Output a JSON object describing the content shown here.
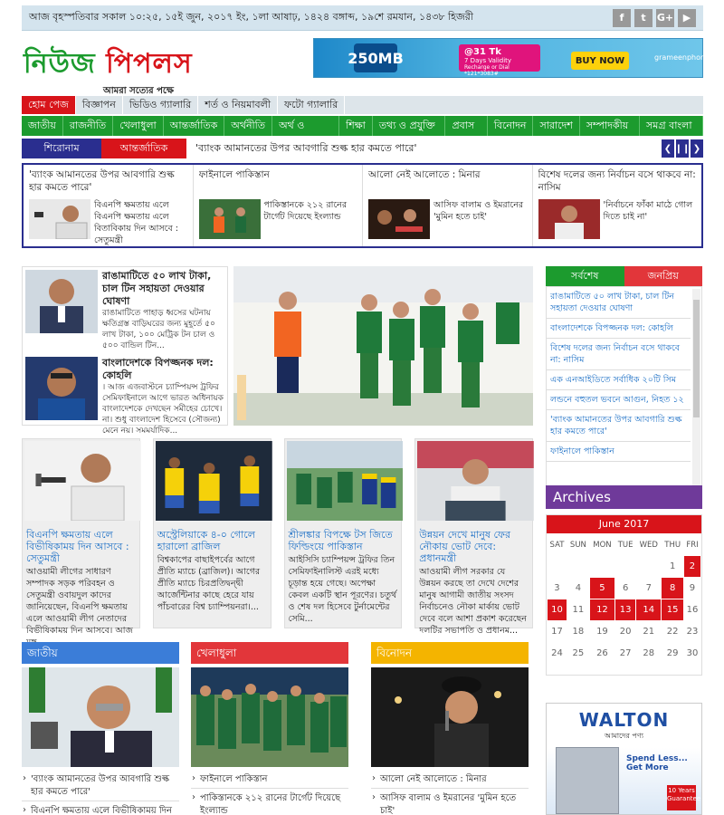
{
  "topbar": {
    "date": "আজ বৃহস্পতিবার সকাল ১০:২৫, ১৫ই জুন, ২০১৭ ইং, ১লা আষাঢ়, ১৪২৪ বঙ্গাব্দ, ১৯শে রমযান, ১৪৩৮ হিজরী",
    "social": [
      "f",
      "t",
      "G+",
      "▶"
    ]
  },
  "logo": {
    "part1": "নিউজ",
    "part2": "পিপলস",
    "tagline": "আমরা সত্যের পক্ষে"
  },
  "ad": {
    "data": "250MB",
    "price": "@31 Tk",
    "validity": "7 Days Validity",
    "recharge": "Recharge or Dial *121*3083#",
    "cta": "BUY NOW",
    "brand": "grameenphone"
  },
  "nav1": [
    "হোম পেজ",
    "বিজ্ঞাপন",
    "ভিডিও গ্যালারি",
    "শর্ত ও নিয়মাবলী",
    "ফটো গ্যালারি"
  ],
  "nav2": [
    "জাতীয়",
    "রাজনীতি",
    "খেলাধুলা",
    "আন্তর্জাতিক",
    "অর্থনীতি",
    "অর্থ ও বাণিজ্য",
    "শিক্ষা",
    "তথ্য ও প্রযুক্তি ▾",
    "প্রবাস ▾",
    "বিনোদন",
    "সারাদেশ",
    "সম্পাদকীয় ▾",
    "সমগ্র বাংলা ▾"
  ],
  "ticker": {
    "head": "শিরোনাম",
    "cat": "আন্তর্জাতিক",
    "text": "'ব্যাংক আমানতের উপর আবগারি শুল্ক হার কমতে পারে'",
    "controls": [
      "❮",
      "❙❙",
      "❯"
    ]
  },
  "strip": [
    {
      "title": "'ব্যাংক আমানতের উপর আবগারি শুল্ক হার কমতে পারে'",
      "sub": "বিএনপি ক্ষমতায় এলে বিএনপি ক্ষমতায় এলে বিতাবিকায় দিন আসবে : সেতুমন্ত্রী"
    },
    {
      "title": "ফাইনালে পাকিস্তান",
      "sub": "পাকিস্তানকে ২১২ রানের টার্গেট দিয়েছে ইংল্যান্ড"
    },
    {
      "title": "আলো নেই আলোতে : মিনার",
      "sub": "আসিফ বালাম ও ইমরানের 'মুমিন হতে চাই'"
    },
    {
      "title": "বিশেষ দলের জন্য নির্বাচন বসে থাকবে না: নাসিম",
      "sub": "'নির্বাচনে ফাঁকা মাঠে গোল দিতে চাই না'"
    }
  ],
  "main_list": [
    {
      "title": "রাঙামাটিতে ৫০ লাখ টাকা, চাল টিন সহায়তা দেওয়ার ঘোষণা",
      "sub": "রাঙামাটিতে পাহাড় ধ্বসের ঘটনায় ক্ষতিগ্রস্ত বাড়িঘরের জন্য মুহূর্তে ৫০ লাখ টাকা, ১০০ মেট্রিক টন চাল ও ৫০০ বান্ডিল টিন..."
    },
    {
      "title": "বাংলাদেশকে বিপজ্জনক দল: কোহলি",
      "sub": "। আজ এজবাস্টনে চ্যাম্পিয়ন্স ট্রফির সেমিফাইনালে আগে ভারত অধিনায়ক বাংলাদেশকে দেখছেন সমীহের চোখে। না। শুধু বাংলাদেশ হিসেবে (সৌজন্য) মেনে নয়। সমমর্যাদিক..."
    }
  ],
  "cards": [
    {
      "title": "বিএনপি ক্ষমতায় এলে বিভীষিকাময় দিন আসবে : সেতুমন্ত্রী",
      "sub": "আওয়ামী লীগের সাধারণ সম্পাদক সড়ক পরিবহন ও সেতুমন্ত্রী ওবায়দুল কাদের জানিয়েছেন, বিএনপি ক্ষমতায় এলে আওয়ামী লীগ নেতাদের বিভীষিকাময় দিন আসবে। আজ মঙ্গ..."
    },
    {
      "title": "অস্ট্রেলিয়াকে ৪-০ গোলে হারালো ব্রাজিল",
      "sub": "বিশ্বকাপের বাছাইপর্বের আগে প্রীতি ম্যাচে (ব্রাজিল)। আগের প্রীতি ম্যাচে চিরপ্রতিদ্বন্দ্বী আর্জেন্টিনার কাছে হেরে যায় পাঁচবারের বিশ্ব চ্যাম্পিয়নরা।..."
    },
    {
      "title": "শ্রীলঙ্কার বিপক্ষে টস জিতে ফিল্ডিংয়ে পাকিস্তান",
      "sub": "আইসিসি চ্যাম্পিয়ন্স ট্রফির তিন সেমিফাইনালিস্ট এরই মধ্যে চূড়ান্ত হয়ে গেছে। অপেক্ষা কেবল একটি স্থান পূরণের। চতুর্থ ও শেষ দল হিসেবে টুর্নামেন্টের সেমি..."
    },
    {
      "title": "উন্নয়ন দেখে মানুষ ফের নৌকায় ভোট দেবে: প্রধানমন্ত্রী",
      "sub": "আওয়ামী লীগ সরকার যে উন্নয়ন করছে তা দেখে দেশের মানুষ আগামী জাতীয় সংসদ নির্বাচনেও নৌকা মার্কায় ভোট দেবে বলে আশা প্রকাশ করেছেন দলটির সভাপতি ও প্রধানম..."
    }
  ],
  "categories": [
    {
      "name": "জাতীয়",
      "color": "#3b7dd8",
      "items": [
        "'ব্যাংক আমানতের উপর আবগারি শুল্ক হার কমতে পারে'",
        "বিএনপি ক্ষমতায় এলে বিভীষিকাময় দিন"
      ]
    },
    {
      "name": "খেলাধুলা",
      "color": "#e2363a",
      "items": [
        "ফাইনালে পাকিস্তান",
        "পাকিস্তানকে ২১২ রানের টার্গেট দিয়েছে ইংল্যান্ড"
      ]
    },
    {
      "name": "বিনোদন",
      "color": "#f4b400",
      "items": [
        "আলো নেই আলোতে : মিনার",
        "আসিফ বালাম ও ইমরানের 'মুমিন হতে চাই'"
      ]
    }
  ],
  "side": {
    "tab1": "সর্বশেষ",
    "tab2": "জনপ্রিয়",
    "latest": [
      "রাঙামাটিতে ৫০ লাখ টাকা, চাল টিন সহায়তা দেওয়ার ঘোষণা",
      "বাংলাদেশকে বিপজ্জনক দল: কোহলি",
      "বিশেষ দলের জন্য নির্বাচন বসে থাকবে না: নাসিম",
      "এক এনআইডিতে সর্বাধিক ২০টি সিম",
      "লন্ডনে বহুতল ভবনে আগুন, নিহত ১২",
      "'ব্যাংক আমানতের উপর আবগারি শুল্ক হার কমতে পারে'",
      "ফাইনালে পাকিস্তান"
    ]
  },
  "archives": {
    "title": "Archives",
    "month": "June 2017",
    "weekdays": [
      "SAT",
      "SUN",
      "MON",
      "TUE",
      "WED",
      "THU",
      "FRI"
    ],
    "weeks": [
      [
        "",
        "",
        "",
        "",
        "",
        "1",
        "2"
      ],
      [
        "3",
        "4",
        "5",
        "6",
        "7",
        "8",
        "9"
      ],
      [
        "10",
        "11",
        "12",
        "13",
        "14",
        "15",
        "16"
      ],
      [
        "17",
        "18",
        "19",
        "20",
        "21",
        "22",
        "23"
      ],
      [
        "24",
        "25",
        "26",
        "27",
        "28",
        "29",
        "30"
      ]
    ],
    "highlighted": [
      "2",
      "5",
      "8",
      "10",
      "12",
      "13",
      "14",
      "15"
    ]
  },
  "walton": {
    "brand": "WALTON",
    "tagline": "আমাদের পণ্য",
    "slogan": "Spend Less... Get More",
    "badge": "10 Years Guarantee"
  }
}
